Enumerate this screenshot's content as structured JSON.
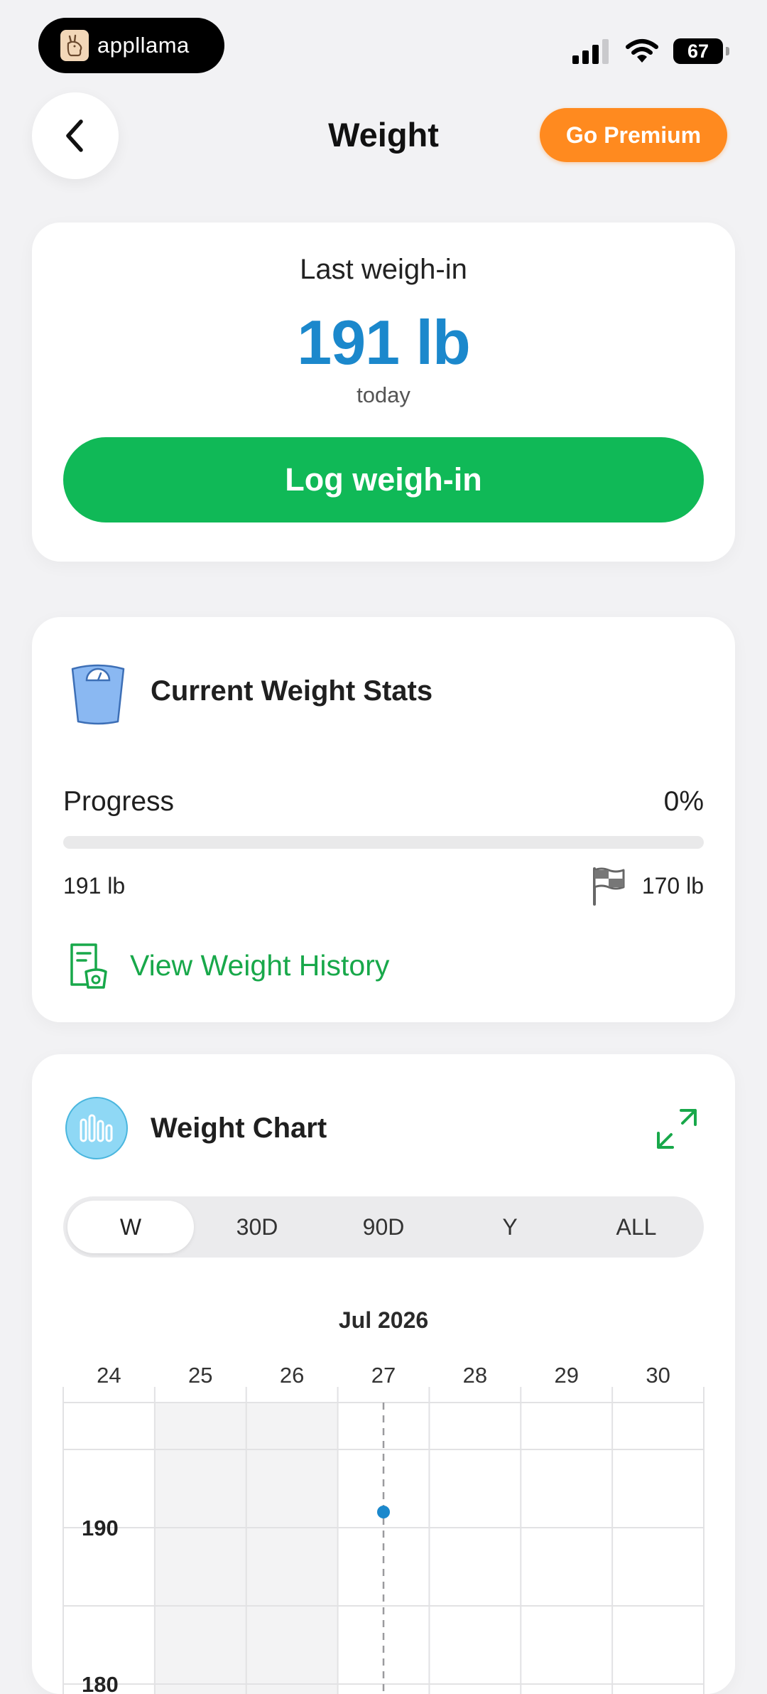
{
  "status_bar": {
    "app_badge": "appllama",
    "battery": "67"
  },
  "nav": {
    "title": "Weight",
    "premium_label": "Go Premium"
  },
  "last_weighin": {
    "label": "Last weigh-in",
    "value": "191 lb",
    "time": "today",
    "button_label": "Log weigh-in"
  },
  "stats": {
    "title": "Current Weight Stats",
    "progress_label": "Progress",
    "progress_pct_text": "0%",
    "progress_value": 0,
    "start_weight": "191 lb",
    "goal_weight": "170 lb",
    "history_link": "View Weight History"
  },
  "chart_card": {
    "title": "Weight Chart",
    "ranges": [
      "W",
      "30D",
      "90D",
      "Y",
      "ALL"
    ],
    "selected_range": "W"
  },
  "colors": {
    "accent_blue": "#1b88cc",
    "accent_green": "#10b957",
    "premium_orange": "#ff8a1f"
  },
  "chart_data": {
    "type": "scatter",
    "title": "Jul 2026",
    "categories": [
      "24",
      "25",
      "26",
      "27",
      "28",
      "29",
      "30"
    ],
    "y_ticks": [
      "190",
      "180"
    ],
    "shaded_days": [
      "25",
      "26"
    ],
    "today": "27",
    "series": [
      {
        "points": [
          {
            "x": "27",
            "y": 191
          }
        ]
      }
    ],
    "ylim": [
      176,
      194
    ],
    "grid": true
  }
}
